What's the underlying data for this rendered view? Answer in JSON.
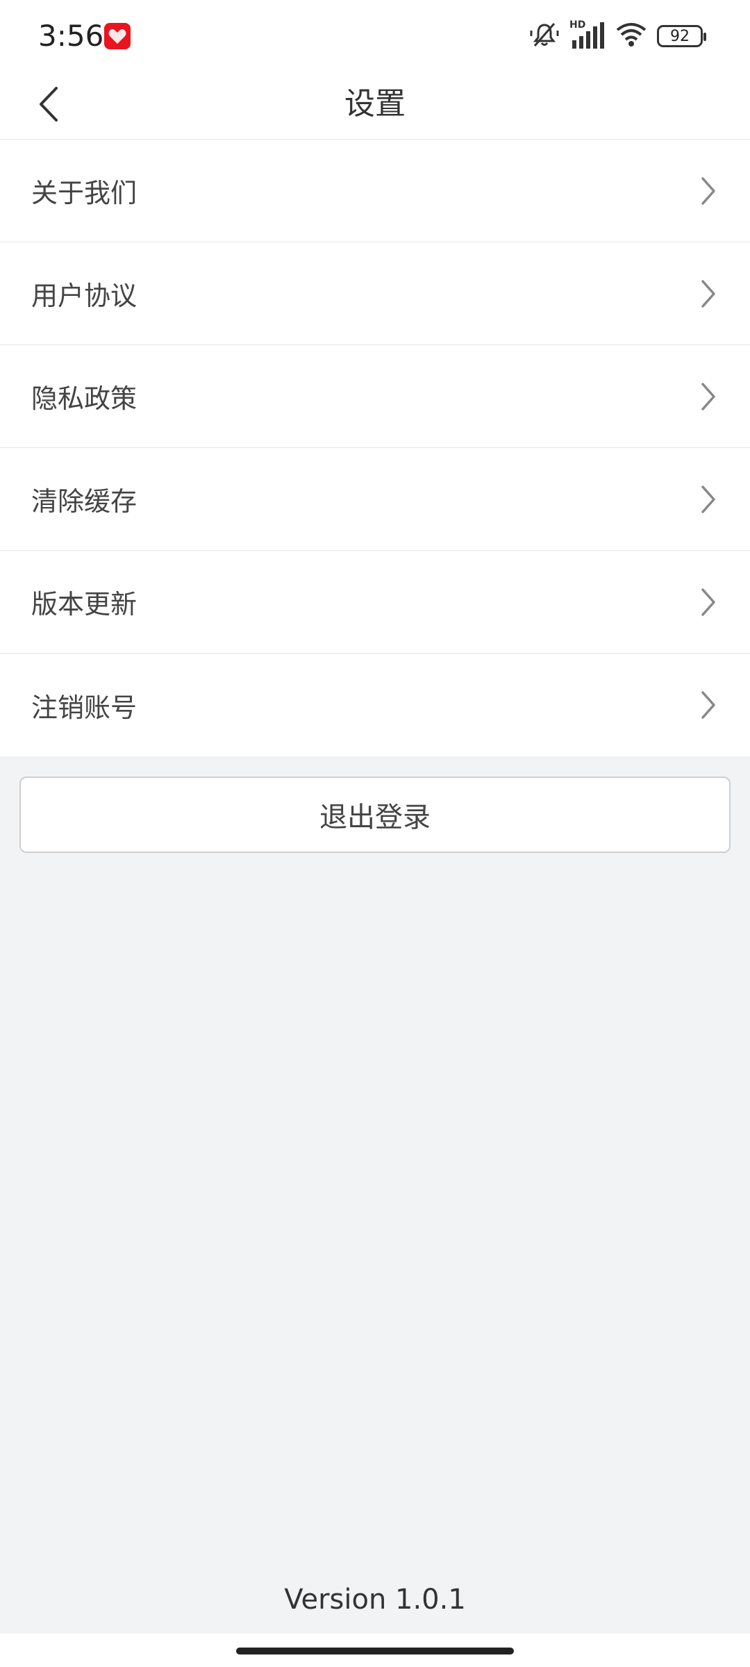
{
  "status_bar": {
    "time": "3:56",
    "battery_level": "92",
    "network_label": "HD",
    "icons": [
      "app-notification-icon",
      "mute-icon",
      "signal-icon",
      "wifi-icon",
      "battery-icon"
    ]
  },
  "header": {
    "title": "设置",
    "back_icon": "chevron-left-icon"
  },
  "menu": {
    "items": [
      {
        "label": "关于我们"
      },
      {
        "label": "用户协议"
      },
      {
        "label": "隐私政策"
      },
      {
        "label": "清除缓存"
      },
      {
        "label": "版本更新"
      },
      {
        "label": "注销账号"
      }
    ],
    "chevron_icon": "chevron-right-icon"
  },
  "logout": {
    "label": "退出登录"
  },
  "footer": {
    "version": "Version 1.0.1"
  },
  "colors": {
    "app_badge": "#e8141f",
    "page_background": "#f2f3f5",
    "card_background": "#ffffff"
  }
}
